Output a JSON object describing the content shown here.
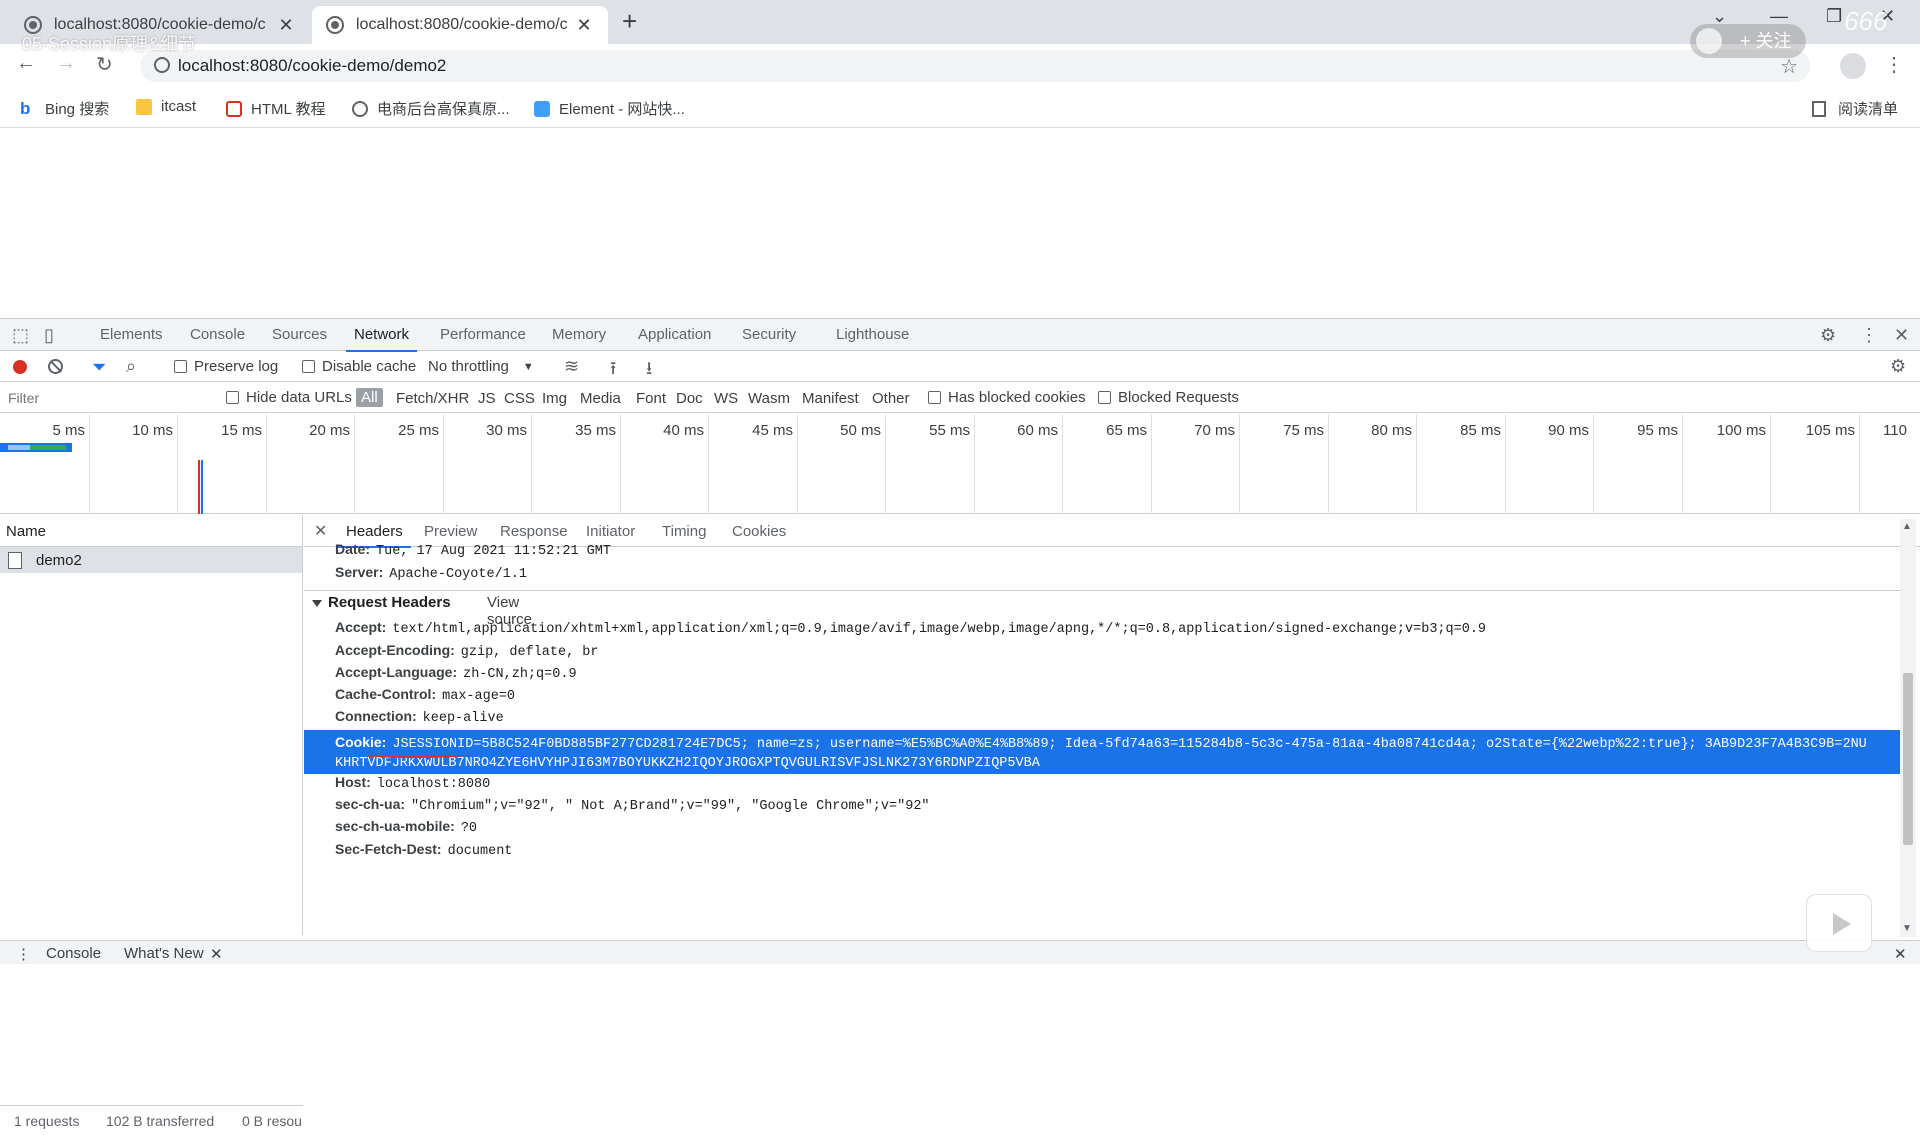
{
  "browser": {
    "tabs": [
      {
        "title": "localhost:8080/cookie-demo/c"
      },
      {
        "title": "localhost:8080/cookie-demo/c"
      }
    ],
    "new_tab": "+",
    "url": "localhost:8080/cookie-demo/demo2",
    "overlay_title": "05-Session原理&细节",
    "follow_label": "+ 关注",
    "watermark": "666",
    "bookmarks": [
      {
        "label": "Bing 搜索",
        "icon": "bing-icon"
      },
      {
        "label": "itcast",
        "icon": "folder-icon"
      },
      {
        "label": "HTML 教程",
        "icon": "html-icon"
      },
      {
        "label": "电商后台高保真原...",
        "icon": "globe-icon"
      },
      {
        "label": "Element - 网站快...",
        "icon": "element-icon"
      }
    ],
    "reading_list": "阅读清单"
  },
  "devtools": {
    "tabs": [
      "Elements",
      "Console",
      "Sources",
      "Network",
      "Performance",
      "Memory",
      "Application",
      "Security",
      "Lighthouse"
    ],
    "active_tab": "Network",
    "network_toolbar": {
      "preserve_log": "Preserve log",
      "disable_cache": "Disable cache",
      "throttling": "No throttling"
    },
    "filter": {
      "placeholder": "Filter",
      "hide_data_urls": "Hide data URLs",
      "types": [
        "All",
        "Fetch/XHR",
        "JS",
        "CSS",
        "Img",
        "Media",
        "Font",
        "Doc",
        "WS",
        "Wasm",
        "Manifest",
        "Other"
      ],
      "has_blocked_cookies": "Has blocked cookies",
      "blocked_requests": "Blocked Requests"
    },
    "timeline_ticks": [
      "5 ms",
      "10 ms",
      "15 ms",
      "20 ms",
      "25 ms",
      "30 ms",
      "35 ms",
      "40 ms",
      "45 ms",
      "50 ms",
      "55 ms",
      "60 ms",
      "65 ms",
      "70 ms",
      "75 ms",
      "80 ms",
      "85 ms",
      "90 ms",
      "95 ms",
      "100 ms",
      "105 ms",
      "110"
    ],
    "name_column": {
      "header": "Name",
      "rows": [
        "demo2"
      ]
    },
    "status": {
      "requests": "1 requests",
      "transferred": "102 B transferred",
      "resources": "0 B resou"
    },
    "detail_tabs": [
      "Headers",
      "Preview",
      "Response",
      "Initiator",
      "Timing",
      "Cookies"
    ],
    "active_detail_tab": "Headers",
    "response_headers_tail": [
      {
        "key": "Date:",
        "value": "Tue, 17 Aug 2021 11:52:21 GMT"
      },
      {
        "key": "Server:",
        "value": "Apache-Coyote/1.1"
      }
    ],
    "request_headers_title": "Request Headers",
    "view_source": "View source",
    "request_headers": [
      {
        "key": "Accept:",
        "value": "text/html,application/xhtml+xml,application/xml;q=0.9,image/avif,image/webp,image/apng,*/*;q=0.8,application/signed-exchange;v=b3;q=0.9"
      },
      {
        "key": "Accept-Encoding:",
        "value": "gzip, deflate, br"
      },
      {
        "key": "Accept-Language:",
        "value": "zh-CN,zh;q=0.9"
      },
      {
        "key": "Cache-Control:",
        "value": "max-age=0"
      },
      {
        "key": "Connection:",
        "value": "keep-alive"
      }
    ],
    "cookie": {
      "key": "Cookie:",
      "line1": "JSESSIONID=5B8C524F0BD885BF277CD281724E7DC5; name=zs; username=%E5%BC%A0%E4%B8%89; Idea-5fd74a63=115284b8-5c3c-475a-81aa-4ba08741cd4a; o2State={%22webp%22:true}; 3AB9D23F7A4B3C9B=2NU",
      "line2": "KHRTVDFJRKXWULB7NRO4ZYE6HVYHPJI63M7BOYUKKZH2IQOYJROGXPTQVGULRISVFJSLNK273Y6RDNPZIQP5VBA"
    },
    "request_headers_after": [
      {
        "key": "Host:",
        "value": "localhost:8080"
      },
      {
        "key": "sec-ch-ua:",
        "value": "\"Chromium\";v=\"92\", \" Not A;Brand\";v=\"99\", \"Google Chrome\";v=\"92\""
      },
      {
        "key": "sec-ch-ua-mobile:",
        "value": "?0"
      },
      {
        "key": "Sec-Fetch-Dest:",
        "value": "document"
      }
    ],
    "drawer_tabs": [
      "Console",
      "What's New"
    ],
    "colors": {
      "accent": "#1a73e8",
      "selection": "#1a73e8",
      "record": "#d93025"
    }
  }
}
